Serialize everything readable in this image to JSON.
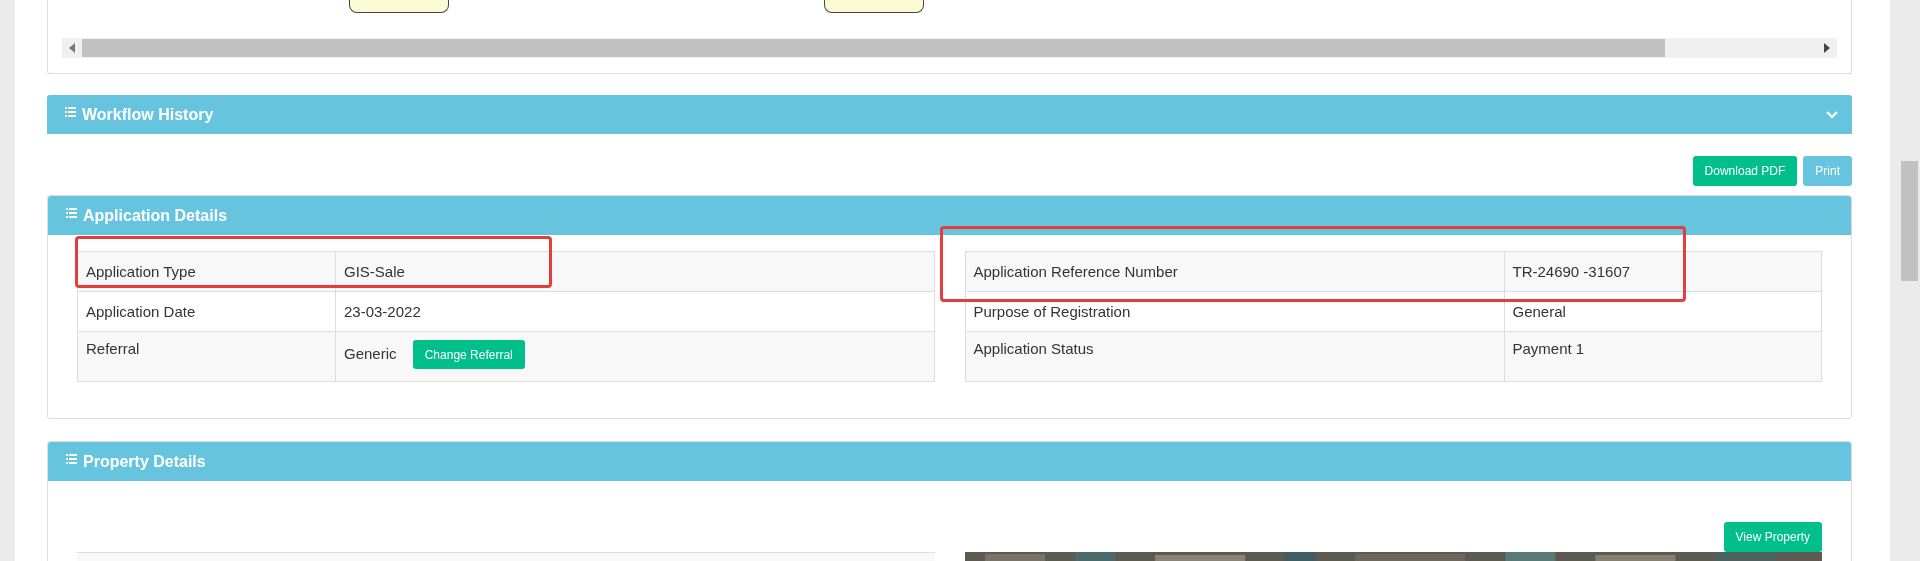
{
  "workflow_history": {
    "title": "Workflow History",
    "expanded": false
  },
  "actions": [
    {
      "label": "Download PDF",
      "kind": "primary"
    },
    {
      "label": "Print",
      "kind": "info"
    }
  ],
  "application_details": {
    "title": "Application Details",
    "left_rows": [
      {
        "label": "Application Type",
        "value": "GIS-Sale",
        "highlighted": true
      },
      {
        "label": "Application Date",
        "value": "23-03-2022",
        "highlighted": false
      },
      {
        "label": "Referral",
        "value": "Generic",
        "button": "Change Referral",
        "highlighted": false
      }
    ],
    "right_rows": [
      {
        "label": "Application Reference Number",
        "value": "TR-24690 -31607",
        "highlighted": true
      },
      {
        "label": "Purpose of Registration",
        "value": "General",
        "highlighted": false
      },
      {
        "label": "Application Status",
        "value": "Payment 1",
        "highlighted": false
      }
    ]
  },
  "property_details": {
    "title": "Property Details",
    "button": "View Property"
  }
}
